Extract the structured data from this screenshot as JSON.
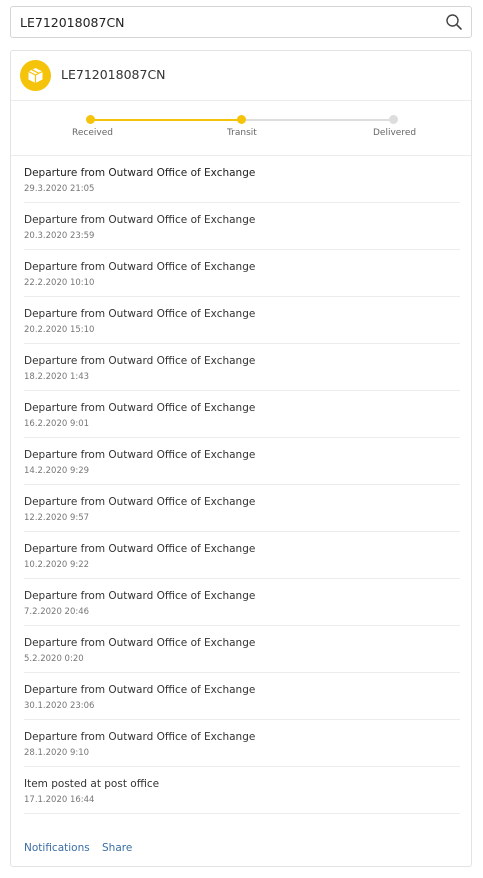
{
  "search": {
    "value": "LE712018087CN",
    "icon": "search-icon"
  },
  "shipment": {
    "tracking_number": "LE712018087CN",
    "icon": "package-icon",
    "accent_color": "#f5c30a"
  },
  "progress": {
    "stages": [
      "Received",
      "Transit",
      "Delivered"
    ],
    "current_stage": "Transit",
    "active_color": "#f5c30a",
    "inactive_color": "#dddddd"
  },
  "events": [
    {
      "title": "Departure from Outward Office of Exchange",
      "time": "29.3.2020 21:05"
    },
    {
      "title": "Departure from Outward Office of Exchange",
      "time": "20.3.2020 23:59"
    },
    {
      "title": "Departure from Outward Office of Exchange",
      "time": "22.2.2020 10:10"
    },
    {
      "title": "Departure from Outward Office of Exchange",
      "time": "20.2.2020 15:10"
    },
    {
      "title": "Departure from Outward Office of Exchange",
      "time": "18.2.2020 1:43"
    },
    {
      "title": "Departure from Outward Office of Exchange",
      "time": "16.2.2020 9:01"
    },
    {
      "title": "Departure from Outward Office of Exchange",
      "time": "14.2.2020 9:29"
    },
    {
      "title": "Departure from Outward Office of Exchange",
      "time": "12.2.2020 9:57"
    },
    {
      "title": "Departure from Outward Office of Exchange",
      "time": "10.2.2020 9:22"
    },
    {
      "title": "Departure from Outward Office of Exchange",
      "time": "7.2.2020 20:46"
    },
    {
      "title": "Departure from Outward Office of Exchange",
      "time": "5.2.2020 0:20"
    },
    {
      "title": "Departure from Outward Office of Exchange",
      "time": "30.1.2020 23:06"
    },
    {
      "title": "Departure from Outward Office of Exchange",
      "time": "28.1.2020 9:10"
    },
    {
      "title": "Item posted at post office",
      "time": "17.1.2020 16:44"
    }
  ],
  "footer": {
    "notifications_label": "Notifications",
    "share_label": "Share",
    "link_color": "#3a6ea5"
  }
}
